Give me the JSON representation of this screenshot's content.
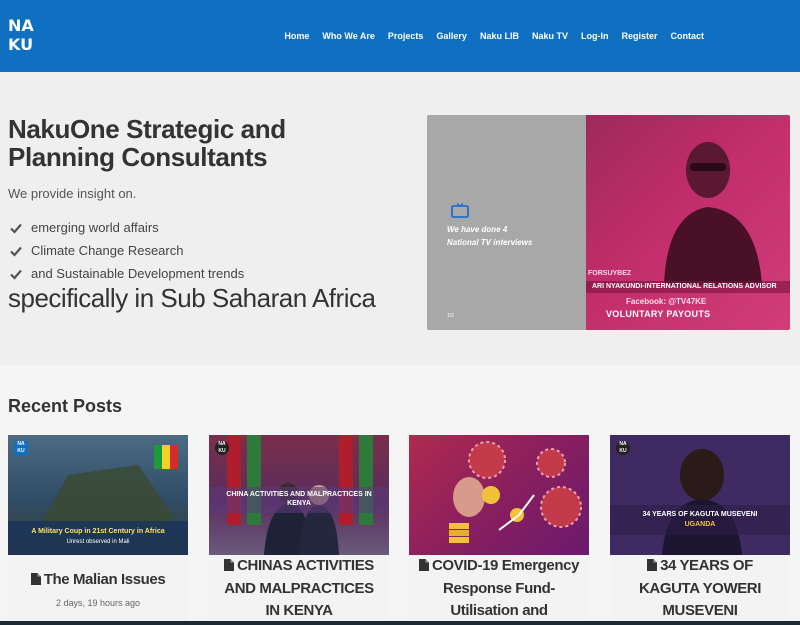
{
  "header": {
    "logo_text_top": "NA",
    "logo_text_bottom": "KU",
    "nav": [
      "Home",
      "Who We Are",
      "Projects",
      "Gallery",
      "Naku LIB",
      "Naku TV",
      "Log-In",
      "Register",
      "Contact"
    ]
  },
  "hero": {
    "title": "NakuOne Strategic and Planning Consultants",
    "intro": "We provide insight on.",
    "bullets": [
      "emerging world affairs",
      "Climate Change Research",
      "and Sustainable Development trends"
    ],
    "tagline": "specifically in Sub Saharan Africa",
    "media": {
      "caption_line1": "We have done 4",
      "caption_line2": "National TV interviews",
      "counter": "1/2",
      "banner_handle": "FORSUYBEZ",
      "banner_name": "ARI NYAKUNDI-INTERNATIONAL RELATIONS ADVISOR",
      "banner_facebook": "Facebook: @TV47KE",
      "banner_payouts": "VOLUNTARY PAYOUTS"
    }
  },
  "recent_posts": {
    "title": "Recent Posts",
    "posts": [
      {
        "title": "The Malian Issues",
        "date": "2 days, 19 hours ago",
        "thumb_caption": "A Military Coup in 21st Century in Africa",
        "thumb_subcaption": "Unrest observed in Mali"
      },
      {
        "title": "CHINAS ACTIVITIES AND MALPRACTICES IN KENYA",
        "date": "",
        "thumb_caption": "CHINA ACTIVITIES AND MALPRACTICES IN KENYA"
      },
      {
        "title": "COVID-19 Emergency Response Fund-Utilisation and",
        "date": "",
        "thumb_caption": ""
      },
      {
        "title": "34 YEARS OF KAGUTA YOWERI MUSEVENI",
        "date": "",
        "thumb_caption": "34 YEARS OF KAGUTA MUSEVENI",
        "thumb_subcaption": "UGANDA"
      }
    ]
  },
  "colors": {
    "header_bg": "#0f70c1",
    "hero_bg": "#efefef",
    "photo_pink": "#c22d6b",
    "text_dark": "#333333"
  },
  "icons": [
    "check-icon",
    "tv-icon",
    "document-icon",
    "naku-logo"
  ]
}
